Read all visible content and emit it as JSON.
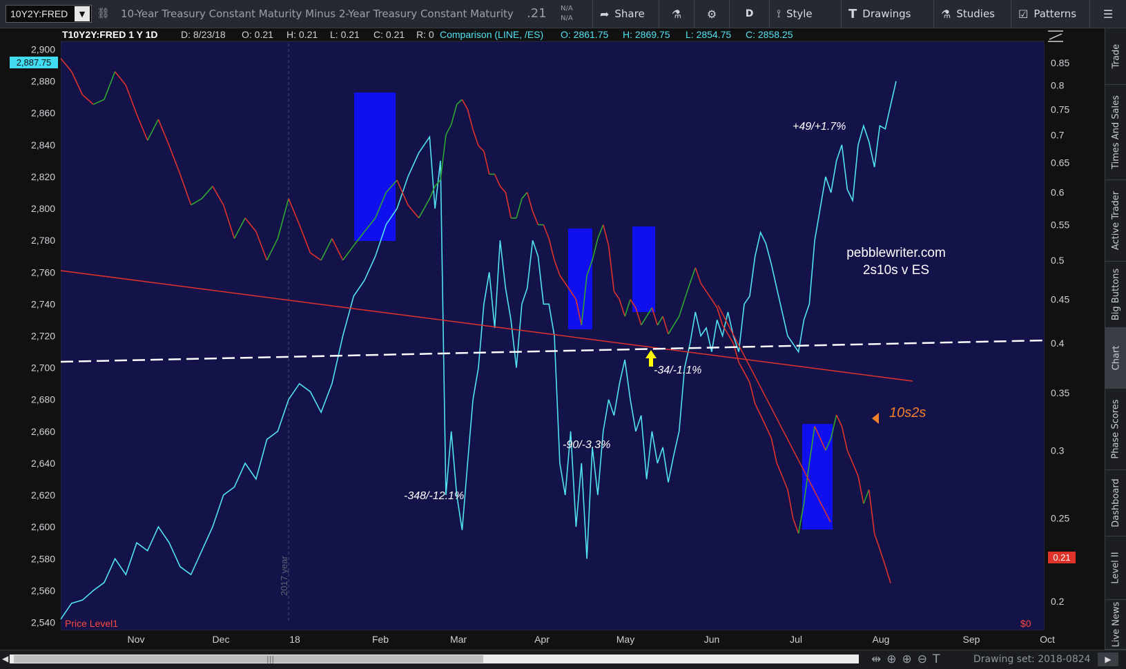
{
  "toolbar": {
    "symbol": "10Y2Y:FRED",
    "description": "10-Year Treasury Constant Maturity Minus 2-Year Treasury Constant Maturity",
    "last_value": ".21",
    "na_1": "N/A",
    "na_2": "N/A",
    "share_label": "Share",
    "period_label": "D",
    "style_label": "Style",
    "drawings_label": "Drawings",
    "studies_label": "Studies",
    "patterns_label": "Patterns"
  },
  "header": {
    "symbol_info": "T10Y2Y:FRED 1 Y 1D",
    "date": "D: 8/23/18",
    "open": "O: 0.21",
    "high": "H: 0.21",
    "low": "L: 0.21",
    "close": "C: 0.21",
    "range": "R: 0",
    "comparison": "Comparison (LINE, /ES)",
    "comp_open": "O: 2861.75",
    "comp_high": "H: 2869.75",
    "comp_low": "L: 2854.75",
    "comp_close": "C: 2858.25"
  },
  "annotations": {
    "site": "pebblewriter.com",
    "subtitle": "2s10s v ES",
    "label_10s2s": "10s2s",
    "a1": "-348/-12.1%",
    "a2": "-90/-3.3%",
    "a3": "-34/-1.1%",
    "a4": "+49/+1.7%",
    "year_marker": "2017 year",
    "price_level": "Price Level1",
    "zero_label": "$0"
  },
  "colors": {
    "plot_bg": "#13134a",
    "es_line": "#52e3f2",
    "spread_up": "#2fa82f",
    "spread_down": "#e0332a",
    "trendline": "#e0332a",
    "dashed": "#ffffff",
    "box": "#1010ee",
    "arrow": "#ffff00",
    "label_orange": "#f0802a"
  },
  "side_tabs": [
    "Trade",
    "Times And Sales",
    "Active Trader",
    "Big Buttons",
    "Chart",
    "Phase Scores",
    "Dashboard",
    "Level II",
    "Live News"
  ],
  "drawing_set": "Drawing set: 2018-0824",
  "chart_data": {
    "type": "line",
    "x_labels": [
      "Nov",
      "Dec",
      "18",
      "Feb",
      "Mar",
      "Apr",
      "May",
      "Jun",
      "Jul",
      "Aug",
      "Sep",
      "Oct"
    ],
    "left_axis": {
      "label": "/ES",
      "range": [
        2535,
        2905
      ],
      "ticks": [
        2540,
        2560,
        2580,
        2600,
        2620,
        2640,
        2660,
        2680,
        2700,
        2720,
        2740,
        2760,
        2780,
        2800,
        2820,
        2840,
        2860,
        2880,
        2900
      ]
    },
    "right_axis": {
      "label": "10Y2Y",
      "range": [
        0.185,
        0.9
      ],
      "log": true,
      "ticks": [
        0.2,
        0.25,
        0.3,
        0.35,
        0.4,
        0.45,
        0.5,
        0.55,
        0.6,
        0.65,
        0.7,
        0.75,
        0.8,
        0.85
      ]
    },
    "left_badge": "2,887.75",
    "right_badge": "0.21",
    "series": [
      {
        "name": "/ES",
        "axis": "left",
        "points": [
          [
            0,
            2542
          ],
          [
            4,
            2552
          ],
          [
            8,
            2554
          ],
          [
            12,
            2560
          ],
          [
            16,
            2565
          ],
          [
            20,
            2580
          ],
          [
            24,
            2570
          ],
          [
            28,
            2590
          ],
          [
            32,
            2585
          ],
          [
            36,
            2600
          ],
          [
            40,
            2590
          ],
          [
            44,
            2575
          ],
          [
            48,
            2570
          ],
          [
            52,
            2585
          ],
          [
            56,
            2600
          ],
          [
            60,
            2620
          ],
          [
            64,
            2625
          ],
          [
            68,
            2640
          ],
          [
            72,
            2630
          ],
          [
            76,
            2655
          ],
          [
            80,
            2660
          ],
          [
            84,
            2680
          ],
          [
            88,
            2690
          ],
          [
            92,
            2685
          ],
          [
            96,
            2672
          ],
          [
            100,
            2690
          ],
          [
            104,
            2720
          ],
          [
            108,
            2745
          ],
          [
            112,
            2755
          ],
          [
            116,
            2770
          ],
          [
            120,
            2790
          ],
          [
            124,
            2800
          ],
          [
            128,
            2820
          ],
          [
            132,
            2835
          ],
          [
            136,
            2845
          ],
          [
            138,
            2800
          ],
          [
            140,
            2830
          ],
          [
            142,
            2620
          ],
          [
            144,
            2660
          ],
          [
            146,
            2620
          ],
          [
            148,
            2598
          ],
          [
            150,
            2640
          ],
          [
            152,
            2680
          ],
          [
            154,
            2700
          ],
          [
            156,
            2740
          ],
          [
            158,
            2760
          ],
          [
            160,
            2725
          ],
          [
            162,
            2780
          ],
          [
            164,
            2750
          ],
          [
            166,
            2730
          ],
          [
            168,
            2700
          ],
          [
            170,
            2740
          ],
          [
            172,
            2750
          ],
          [
            174,
            2780
          ],
          [
            176,
            2770
          ],
          [
            178,
            2740
          ],
          [
            180,
            2740
          ],
          [
            182,
            2720
          ],
          [
            184,
            2640
          ],
          [
            186,
            2620
          ],
          [
            188,
            2660
          ],
          [
            190,
            2600
          ],
          [
            192,
            2640
          ],
          [
            194,
            2580
          ],
          [
            196,
            2650
          ],
          [
            198,
            2620
          ],
          [
            200,
            2660
          ],
          [
            202,
            2680
          ],
          [
            204,
            2670
          ],
          [
            206,
            2690
          ],
          [
            208,
            2705
          ],
          [
            210,
            2680
          ],
          [
            212,
            2660
          ],
          [
            214,
            2670
          ],
          [
            216,
            2630
          ],
          [
            218,
            2660
          ],
          [
            220,
            2640
          ],
          [
            222,
            2650
          ],
          [
            224,
            2628
          ],
          [
            226,
            2645
          ],
          [
            228,
            2660
          ],
          [
            230,
            2700
          ],
          [
            232,
            2715
          ],
          [
            234,
            2735
          ],
          [
            236,
            2720
          ],
          [
            238,
            2725
          ],
          [
            240,
            2710
          ],
          [
            242,
            2730
          ],
          [
            244,
            2720
          ],
          [
            246,
            2735
          ],
          [
            248,
            2720
          ],
          [
            250,
            2710
          ],
          [
            252,
            2740
          ],
          [
            254,
            2745
          ],
          [
            256,
            2770
          ],
          [
            258,
            2785
          ],
          [
            260,
            2778
          ],
          [
            262,
            2765
          ],
          [
            264,
            2750
          ],
          [
            266,
            2735
          ],
          [
            268,
            2720
          ],
          [
            270,
            2715
          ],
          [
            272,
            2710
          ],
          [
            274,
            2730
          ],
          [
            276,
            2740
          ],
          [
            278,
            2780
          ],
          [
            280,
            2800
          ],
          [
            282,
            2820
          ],
          [
            284,
            2810
          ],
          [
            286,
            2830
          ],
          [
            288,
            2840
          ],
          [
            290,
            2812
          ],
          [
            292,
            2805
          ],
          [
            294,
            2840
          ],
          [
            296,
            2852
          ],
          [
            298,
            2842
          ],
          [
            300,
            2826
          ],
          [
            302,
            2852
          ],
          [
            304,
            2850
          ],
          [
            306,
            2865
          ],
          [
            308,
            2880
          ]
        ]
      },
      {
        "name": "10Y2Y",
        "axis": "right",
        "points": [
          [
            0,
            0.86
          ],
          [
            4,
            0.83
          ],
          [
            8,
            0.78
          ],
          [
            12,
            0.76
          ],
          [
            16,
            0.77
          ],
          [
            20,
            0.83
          ],
          [
            24,
            0.8
          ],
          [
            28,
            0.74
          ],
          [
            32,
            0.69
          ],
          [
            36,
            0.73
          ],
          [
            40,
            0.68
          ],
          [
            44,
            0.63
          ],
          [
            48,
            0.58
          ],
          [
            52,
            0.59
          ],
          [
            56,
            0.61
          ],
          [
            60,
            0.58
          ],
          [
            64,
            0.53
          ],
          [
            68,
            0.56
          ],
          [
            72,
            0.54
          ],
          [
            76,
            0.5
          ],
          [
            80,
            0.53
          ],
          [
            84,
            0.59
          ],
          [
            88,
            0.55
          ],
          [
            92,
            0.51
          ],
          [
            96,
            0.5
          ],
          [
            100,
            0.53
          ],
          [
            104,
            0.5
          ],
          [
            108,
            0.52
          ],
          [
            112,
            0.54
          ],
          [
            116,
            0.56
          ],
          [
            120,
            0.6
          ],
          [
            124,
            0.62
          ],
          [
            128,
            0.58
          ],
          [
            132,
            0.56
          ],
          [
            136,
            0.59
          ],
          [
            138,
            0.61
          ],
          [
            140,
            0.62
          ],
          [
            142,
            0.7
          ],
          [
            144,
            0.72
          ],
          [
            146,
            0.76
          ],
          [
            148,
            0.77
          ],
          [
            150,
            0.75
          ],
          [
            152,
            0.71
          ],
          [
            154,
            0.68
          ],
          [
            156,
            0.67
          ],
          [
            158,
            0.63
          ],
          [
            160,
            0.63
          ],
          [
            162,
            0.61
          ],
          [
            164,
            0.6
          ],
          [
            166,
            0.56
          ],
          [
            168,
            0.56
          ],
          [
            170,
            0.59
          ],
          [
            172,
            0.6
          ],
          [
            174,
            0.57
          ],
          [
            176,
            0.55
          ],
          [
            178,
            0.55
          ],
          [
            180,
            0.53
          ],
          [
            182,
            0.5
          ],
          [
            184,
            0.48
          ],
          [
            186,
            0.47
          ],
          [
            188,
            0.46
          ],
          [
            190,
            0.45
          ],
          [
            192,
            0.42
          ],
          [
            194,
            0.48
          ],
          [
            196,
            0.5
          ],
          [
            198,
            0.53
          ],
          [
            200,
            0.55
          ],
          [
            202,
            0.52
          ],
          [
            204,
            0.46
          ],
          [
            206,
            0.45
          ],
          [
            208,
            0.43
          ],
          [
            210,
            0.45
          ],
          [
            212,
            0.44
          ],
          [
            214,
            0.42
          ],
          [
            216,
            0.43
          ],
          [
            218,
            0.44
          ],
          [
            220,
            0.42
          ],
          [
            222,
            0.43
          ],
          [
            224,
            0.41
          ],
          [
            226,
            0.42
          ],
          [
            228,
            0.43
          ],
          [
            230,
            0.45
          ],
          [
            232,
            0.47
          ],
          [
            234,
            0.49
          ],
          [
            236,
            0.47
          ],
          [
            238,
            0.46
          ],
          [
            240,
            0.45
          ],
          [
            242,
            0.44
          ],
          [
            244,
            0.42
          ],
          [
            246,
            0.41
          ],
          [
            248,
            0.4
          ],
          [
            250,
            0.38
          ],
          [
            252,
            0.37
          ],
          [
            254,
            0.36
          ],
          [
            256,
            0.34
          ],
          [
            258,
            0.33
          ],
          [
            260,
            0.32
          ],
          [
            262,
            0.31
          ],
          [
            264,
            0.29
          ],
          [
            266,
            0.28
          ],
          [
            268,
            0.27
          ],
          [
            270,
            0.25
          ],
          [
            272,
            0.24
          ],
          [
            274,
            0.26
          ],
          [
            276,
            0.29
          ],
          [
            278,
            0.32
          ],
          [
            280,
            0.31
          ],
          [
            282,
            0.3
          ],
          [
            284,
            0.31
          ],
          [
            286,
            0.33
          ],
          [
            288,
            0.32
          ],
          [
            290,
            0.3
          ],
          [
            292,
            0.29
          ],
          [
            294,
            0.28
          ],
          [
            296,
            0.26
          ],
          [
            298,
            0.27
          ],
          [
            300,
            0.24
          ],
          [
            302,
            0.23
          ],
          [
            304,
            0.22
          ],
          [
            306,
            0.21
          ]
        ]
      }
    ]
  }
}
